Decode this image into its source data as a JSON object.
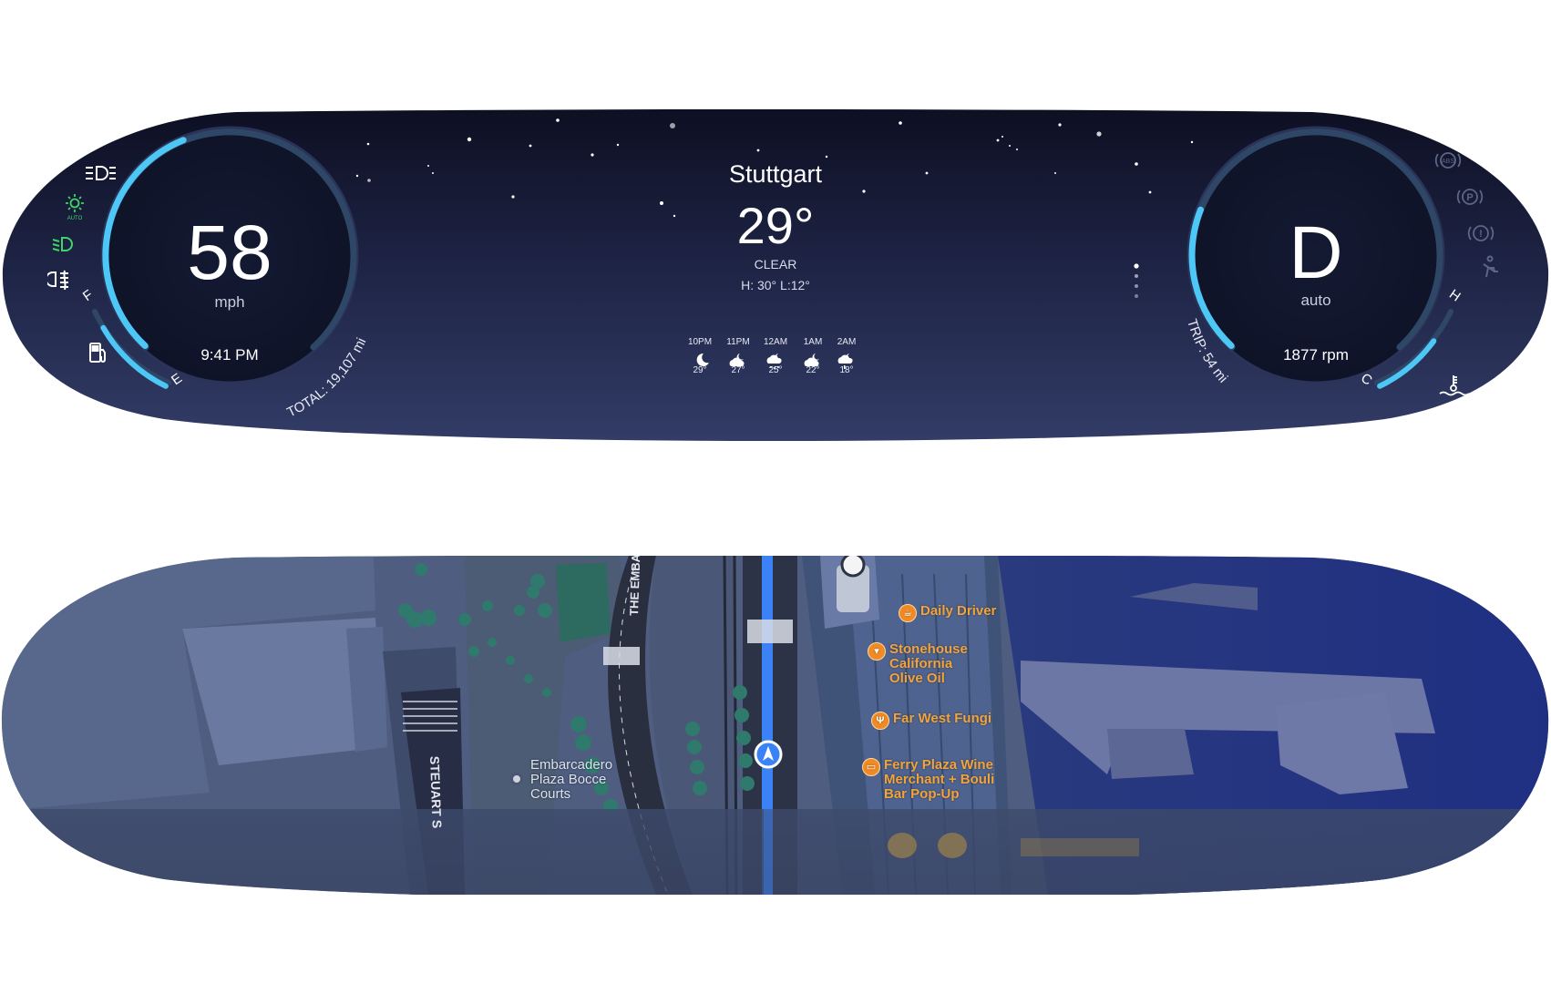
{
  "speed_gauge": {
    "speed": "58",
    "unit": "mph",
    "time": "9:41 PM",
    "total_label": "TOTAL: 19,107 mi",
    "fuel_full": "F",
    "fuel_empty": "E",
    "fuel_level_fraction": 0.55,
    "speed_arc_fraction": 0.42
  },
  "left_indicators": [
    {
      "icon": "high-beam-icon",
      "color": "#ffffff"
    },
    {
      "icon": "auto-headlight-icon",
      "color": "#3fd36a",
      "text": "AUTO"
    },
    {
      "icon": "low-beam-icon",
      "color": "#3fd36a"
    },
    {
      "icon": "fog-light-icon",
      "color": "#ffffff"
    },
    {
      "icon": "fuel-pump-icon",
      "color": "#ffffff"
    }
  ],
  "weather": {
    "city": "Stuttgart",
    "temperature": "29°",
    "condition": "CLEAR",
    "high_low": "H: 30° L:12°",
    "hourly": [
      {
        "time": "10PM",
        "icon": "moon-icon",
        "temp": "29°"
      },
      {
        "time": "11PM",
        "icon": "cloudy-night-icon",
        "temp": "27°"
      },
      {
        "time": "12AM",
        "icon": "snow-night-icon",
        "temp": "25°"
      },
      {
        "time": "1AM",
        "icon": "cloudy-night-icon",
        "temp": "22°"
      },
      {
        "time": "2AM",
        "icon": "rain-night-icon",
        "temp": "18°"
      }
    ]
  },
  "gear_gauge": {
    "gear": "D",
    "mode": "auto",
    "rpm": "1877 rpm",
    "trip_label": "TRIP: 54 mi",
    "temp_hot": "H",
    "temp_cold": "C",
    "temp_level_fraction": 0.45,
    "rpm_arc_fraction": 0.25
  },
  "right_indicators": [
    {
      "icon": "abs-warning-icon",
      "text": "ABS"
    },
    {
      "icon": "parking-brake-icon",
      "text": "P"
    },
    {
      "icon": "brake-warning-icon",
      "text": "!"
    },
    {
      "icon": "seatbelt-icon"
    },
    {
      "icon": "coolant-temp-icon"
    }
  ],
  "map": {
    "road_label": "THE EMBAR",
    "street_label": "STEUART S",
    "place_label": [
      "Embarcadero",
      "Plaza Bocce",
      "Courts"
    ],
    "pois": [
      {
        "icon": "cafe-icon",
        "lines": [
          "Daily Driver"
        ]
      },
      {
        "icon": "shopping-basket-icon",
        "lines": [
          "Stonehouse",
          "California",
          "Olive Oil"
        ]
      },
      {
        "icon": "restaurant-icon",
        "lines": [
          "Far West Fungi"
        ]
      },
      {
        "icon": "wine-bar-icon",
        "lines": [
          "Ferry Plaza Wine",
          "Merchant + Bouli",
          "Bar Pop-Up"
        ]
      }
    ],
    "colors": {
      "route": "#3b82f6",
      "water": "#1f2f7a",
      "land": "#4a5a7e",
      "poi": "#f2a33a"
    }
  }
}
